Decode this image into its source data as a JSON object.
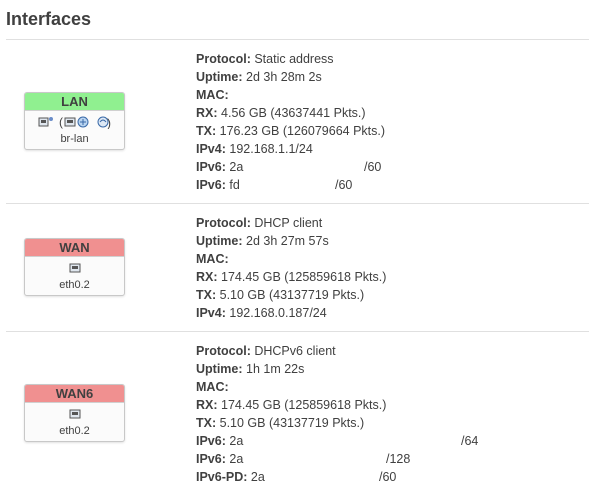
{
  "page": {
    "title": "Interfaces"
  },
  "interfaces": [
    {
      "name": "LAN",
      "color": "#90f090",
      "device": "br-lan",
      "icons": [
        "ethernet-port-icon",
        "bridge-icon",
        "wireless-icon"
      ],
      "protocol_label": "Protocol:",
      "protocol": "Static address",
      "uptime_label": "Uptime:",
      "uptime": "2d 3h 28m 2s",
      "mac_label": "MAC:",
      "rx_label": "RX:",
      "rx": "4.56 GB (43637441 Pkts.)",
      "tx_label": "TX:",
      "tx": "176.23 GB (126079664 Pkts.)",
      "ipv4_label": "IPv4:",
      "ipv4": "192.168.1.1/24",
      "ipv6_label": "IPv6:",
      "ipv6": [
        {
          "prefix": "2a",
          "suffix": "/60"
        },
        {
          "prefix": "fd",
          "suffix": "/60"
        }
      ]
    },
    {
      "name": "WAN",
      "color": "#f09090",
      "device": "eth0.2",
      "icons": [
        "ethernet-port-icon"
      ],
      "protocol_label": "Protocol:",
      "protocol": "DHCP client",
      "uptime_label": "Uptime:",
      "uptime": "2d 3h 27m 57s",
      "mac_label": "MAC:",
      "rx_label": "RX:",
      "rx": "174.45 GB (125859618 Pkts.)",
      "tx_label": "TX:",
      "tx": "5.10 GB (43137719 Pkts.)",
      "ipv4_label": "IPv4:",
      "ipv4": "192.168.0.187/24"
    },
    {
      "name": "WAN6",
      "color": "#f09090",
      "device": "eth0.2",
      "icons": [
        "ethernet-port-icon"
      ],
      "protocol_label": "Protocol:",
      "protocol": "DHCPv6 client",
      "uptime_label": "Uptime:",
      "uptime": "1h 1m 22s",
      "mac_label": "MAC:",
      "rx_label": "RX:",
      "rx": "174.45 GB (125859618 Pkts.)",
      "tx_label": "TX:",
      "tx": "5.10 GB (43137719 Pkts.)",
      "ipv6_label": "IPv6:",
      "ipv6": [
        {
          "prefix": "2a",
          "suffix": "/64"
        },
        {
          "prefix": "2a",
          "suffix": "/128"
        }
      ],
      "ipv6pd_label": "IPv6-PD:",
      "ipv6pd": {
        "prefix": "2a",
        "suffix": "/60"
      }
    }
  ]
}
